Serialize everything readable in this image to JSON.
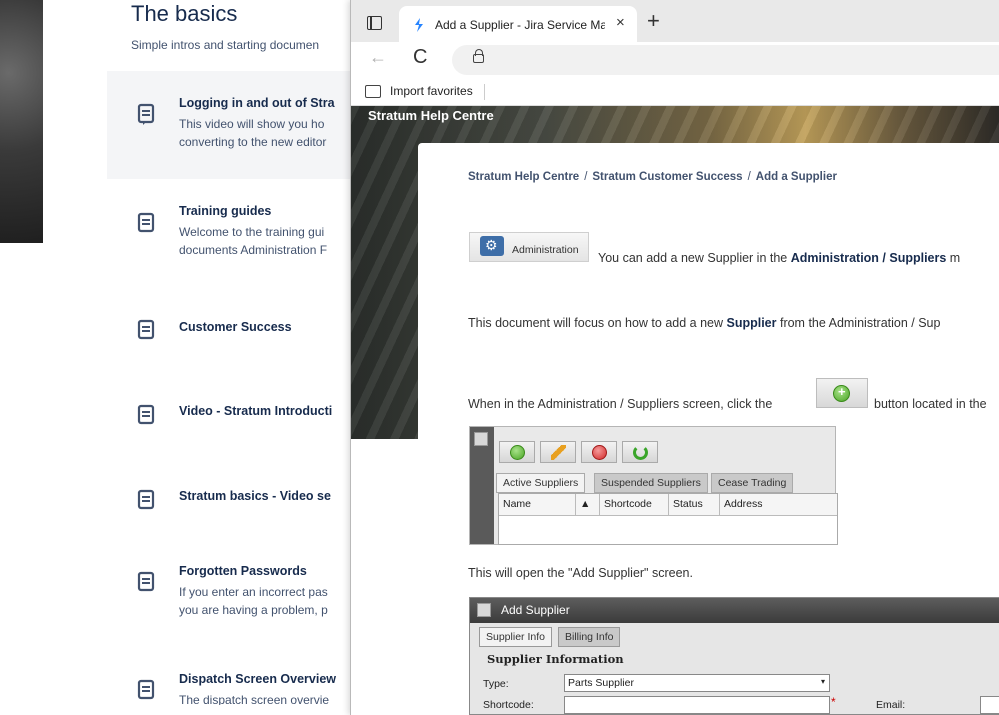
{
  "background_page": {
    "title": "The basics",
    "subtitle": "Simple intros and starting documen",
    "items": [
      {
        "title": "Logging in and out of Stra",
        "desc1": "This video will show you ho",
        "desc2": "converting to the new editor"
      },
      {
        "title": "Training guides",
        "desc1": "Welcome to the training gui",
        "desc2": "documents Administration F"
      },
      {
        "title": "Customer Success",
        "desc1": "",
        "desc2": ""
      },
      {
        "title": "Video - Stratum Introducti",
        "desc1": "",
        "desc2": ""
      },
      {
        "title": "Stratum basics - Video se",
        "desc1": "",
        "desc2": ""
      },
      {
        "title": "Forgotten Passwords",
        "desc1": "If you enter an incorrect pas",
        "desc2": "you are having a problem, p"
      },
      {
        "title": "Dispatch Screen Overview",
        "desc1": "The dispatch screen overvie",
        "desc2": ""
      }
    ]
  },
  "browser": {
    "tab_title": "Add a Supplier - Jira Service Man",
    "close_glyph": "×",
    "new_tab_glyph": "+",
    "back_glyph": "←",
    "reload_glyph": "C",
    "favorites_label": "Import favorites"
  },
  "page": {
    "help_centre": "Stratum Help Centre",
    "breadcrumb": [
      "Stratum Help Centre",
      "Stratum Customer Success",
      "Add a Supplier"
    ],
    "breadcrumb_sep": "/",
    "admin_button_label": "Administration",
    "para1_pre": "You can add a new Supplier in the ",
    "para1_bold": "Administration / Suppliers",
    "para1_post": " m",
    "para2_pre": "This document will focus on how to add a new ",
    "para2_bold": "Supplier",
    "para2_post": " from the Administration / Sup",
    "para3_pre": "When in the Administration / Suppliers screen, click the",
    "para3_post": "button located in the",
    "para4": "This will open the \"Add Supplier\" screen."
  },
  "suppliers_screen": {
    "tabs": [
      "Active Suppliers",
      "Suspended Suppliers",
      "Cease Trading"
    ],
    "columns": [
      "Name",
      "▲",
      "Shortcode",
      "Status",
      "Address"
    ]
  },
  "add_supplier_screen": {
    "title": "Add Supplier",
    "tabs": [
      "Supplier Info",
      "Billing Info"
    ],
    "group": "Supplier Information",
    "type_label": "Type:",
    "type_value": "Parts Supplier",
    "shortcode_label": "Shortcode:",
    "required_mark": "*",
    "email_label": "Email:"
  }
}
